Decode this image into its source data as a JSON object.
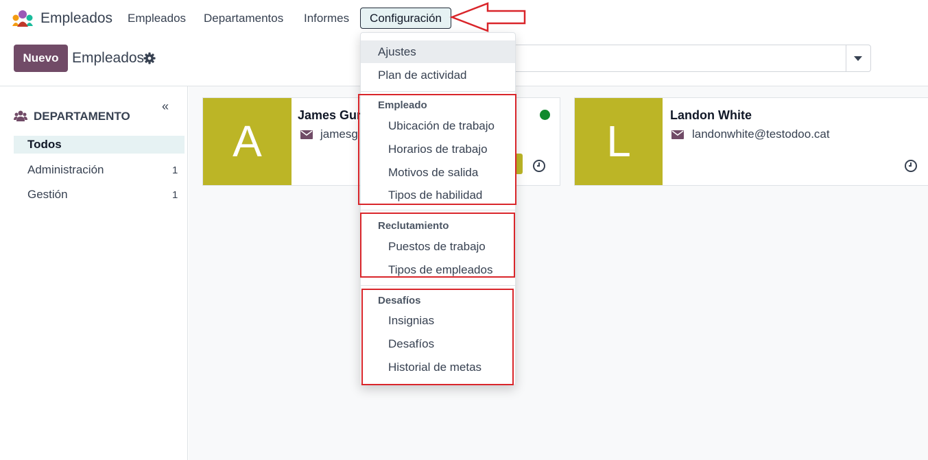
{
  "navbar": {
    "app_name": "Empleados",
    "menu": [
      "Empleados",
      "Departamentos",
      "Informes",
      "Configuración"
    ]
  },
  "control_panel": {
    "new_button": "Nuevo",
    "breadcrumb": "Empleados",
    "search_placeholder_fragment": "."
  },
  "sidebar": {
    "title": "DEPARTAMENTO",
    "items": [
      {
        "label": "Todos",
        "count": ""
      },
      {
        "label": "Administración",
        "count": "1"
      },
      {
        "label": "Gestión",
        "count": "1"
      }
    ]
  },
  "cards": [
    {
      "initial": "A",
      "name": "James Gur",
      "email": "jamesg",
      "status": "online"
    },
    {
      "initial": "L",
      "name": "Landon White",
      "email": "landonwhite@testodoo.cat"
    }
  ],
  "dropdown": {
    "top_items": [
      "Ajustes",
      "Plan de actividad"
    ],
    "sections": [
      {
        "header": "Empleado",
        "items": [
          "Ubicación de trabajo",
          "Horarios de trabajo",
          "Motivos de salida",
          "Tipos de habilidad"
        ]
      },
      {
        "header": "Reclutamiento",
        "items": [
          "Puestos de trabajo",
          "Tipos de empleados"
        ]
      },
      {
        "header": "Desafíos",
        "items": [
          "Insignias",
          "Desafíos",
          "Historial de metas"
        ]
      }
    ]
  },
  "colors": {
    "brand": "#714b67",
    "avatar_bg": "#bcb526",
    "active_bg": "#e6f2f3",
    "annotation_red": "#d9252a",
    "status_online": "#118a2d"
  }
}
